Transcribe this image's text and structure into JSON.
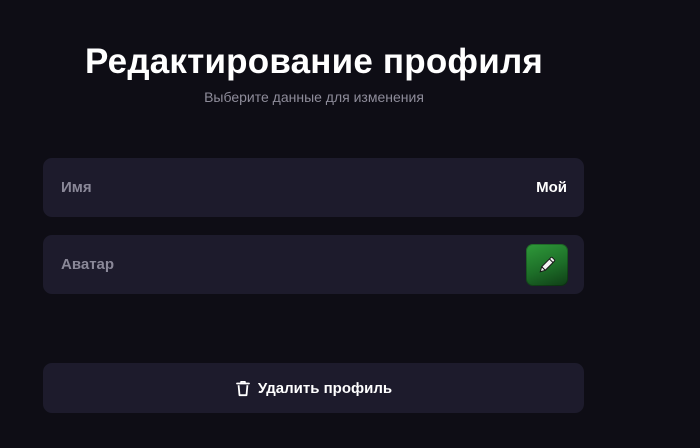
{
  "header": {
    "title": "Редактирование профиля",
    "subtitle": "Выберите данные для изменения"
  },
  "fields": {
    "name": {
      "label": "Имя",
      "value": "Мой"
    },
    "avatar": {
      "label": "Аватар",
      "icon": "pencil-edit-icon"
    }
  },
  "actions": {
    "delete_label": "Удалить профиль",
    "delete_icon": "trash-icon"
  },
  "colors": {
    "background": "#0e0d15",
    "card": "#1d1b2c",
    "avatar_green": "#2f9a3a",
    "muted_text": "#8a8898"
  }
}
